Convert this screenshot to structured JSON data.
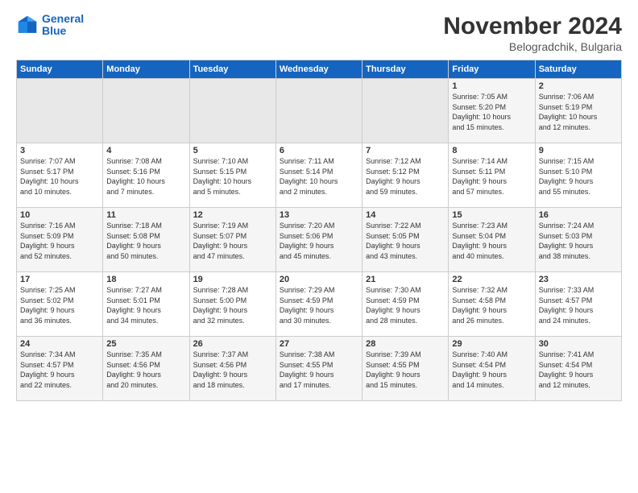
{
  "logo": {
    "line1": "General",
    "line2": "Blue"
  },
  "title": "November 2024",
  "subtitle": "Belogradchik, Bulgaria",
  "days_of_week": [
    "Sunday",
    "Monday",
    "Tuesday",
    "Wednesday",
    "Thursday",
    "Friday",
    "Saturday"
  ],
  "weeks": [
    {
      "days": [
        {
          "num": "",
          "info": "",
          "empty": true
        },
        {
          "num": "",
          "info": "",
          "empty": true
        },
        {
          "num": "",
          "info": "",
          "empty": true
        },
        {
          "num": "",
          "info": "",
          "empty": true
        },
        {
          "num": "",
          "info": "",
          "empty": true
        },
        {
          "num": "1",
          "info": "Sunrise: 7:05 AM\nSunset: 5:20 PM\nDaylight: 10 hours\nand 15 minutes."
        },
        {
          "num": "2",
          "info": "Sunrise: 7:06 AM\nSunset: 5:19 PM\nDaylight: 10 hours\nand 12 minutes."
        }
      ]
    },
    {
      "days": [
        {
          "num": "3",
          "info": "Sunrise: 7:07 AM\nSunset: 5:17 PM\nDaylight: 10 hours\nand 10 minutes."
        },
        {
          "num": "4",
          "info": "Sunrise: 7:08 AM\nSunset: 5:16 PM\nDaylight: 10 hours\nand 7 minutes."
        },
        {
          "num": "5",
          "info": "Sunrise: 7:10 AM\nSunset: 5:15 PM\nDaylight: 10 hours\nand 5 minutes."
        },
        {
          "num": "6",
          "info": "Sunrise: 7:11 AM\nSunset: 5:14 PM\nDaylight: 10 hours\nand 2 minutes."
        },
        {
          "num": "7",
          "info": "Sunrise: 7:12 AM\nSunset: 5:12 PM\nDaylight: 9 hours\nand 59 minutes."
        },
        {
          "num": "8",
          "info": "Sunrise: 7:14 AM\nSunset: 5:11 PM\nDaylight: 9 hours\nand 57 minutes."
        },
        {
          "num": "9",
          "info": "Sunrise: 7:15 AM\nSunset: 5:10 PM\nDaylight: 9 hours\nand 55 minutes."
        }
      ]
    },
    {
      "days": [
        {
          "num": "10",
          "info": "Sunrise: 7:16 AM\nSunset: 5:09 PM\nDaylight: 9 hours\nand 52 minutes."
        },
        {
          "num": "11",
          "info": "Sunrise: 7:18 AM\nSunset: 5:08 PM\nDaylight: 9 hours\nand 50 minutes."
        },
        {
          "num": "12",
          "info": "Sunrise: 7:19 AM\nSunset: 5:07 PM\nDaylight: 9 hours\nand 47 minutes."
        },
        {
          "num": "13",
          "info": "Sunrise: 7:20 AM\nSunset: 5:06 PM\nDaylight: 9 hours\nand 45 minutes."
        },
        {
          "num": "14",
          "info": "Sunrise: 7:22 AM\nSunset: 5:05 PM\nDaylight: 9 hours\nand 43 minutes."
        },
        {
          "num": "15",
          "info": "Sunrise: 7:23 AM\nSunset: 5:04 PM\nDaylight: 9 hours\nand 40 minutes."
        },
        {
          "num": "16",
          "info": "Sunrise: 7:24 AM\nSunset: 5:03 PM\nDaylight: 9 hours\nand 38 minutes."
        }
      ]
    },
    {
      "days": [
        {
          "num": "17",
          "info": "Sunrise: 7:25 AM\nSunset: 5:02 PM\nDaylight: 9 hours\nand 36 minutes."
        },
        {
          "num": "18",
          "info": "Sunrise: 7:27 AM\nSunset: 5:01 PM\nDaylight: 9 hours\nand 34 minutes."
        },
        {
          "num": "19",
          "info": "Sunrise: 7:28 AM\nSunset: 5:00 PM\nDaylight: 9 hours\nand 32 minutes."
        },
        {
          "num": "20",
          "info": "Sunrise: 7:29 AM\nSunset: 4:59 PM\nDaylight: 9 hours\nand 30 minutes."
        },
        {
          "num": "21",
          "info": "Sunrise: 7:30 AM\nSunset: 4:59 PM\nDaylight: 9 hours\nand 28 minutes."
        },
        {
          "num": "22",
          "info": "Sunrise: 7:32 AM\nSunset: 4:58 PM\nDaylight: 9 hours\nand 26 minutes."
        },
        {
          "num": "23",
          "info": "Sunrise: 7:33 AM\nSunset: 4:57 PM\nDaylight: 9 hours\nand 24 minutes."
        }
      ]
    },
    {
      "days": [
        {
          "num": "24",
          "info": "Sunrise: 7:34 AM\nSunset: 4:57 PM\nDaylight: 9 hours\nand 22 minutes."
        },
        {
          "num": "25",
          "info": "Sunrise: 7:35 AM\nSunset: 4:56 PM\nDaylight: 9 hours\nand 20 minutes."
        },
        {
          "num": "26",
          "info": "Sunrise: 7:37 AM\nSunset: 4:56 PM\nDaylight: 9 hours\nand 18 minutes."
        },
        {
          "num": "27",
          "info": "Sunrise: 7:38 AM\nSunset: 4:55 PM\nDaylight: 9 hours\nand 17 minutes."
        },
        {
          "num": "28",
          "info": "Sunrise: 7:39 AM\nSunset: 4:55 PM\nDaylight: 9 hours\nand 15 minutes."
        },
        {
          "num": "29",
          "info": "Sunrise: 7:40 AM\nSunset: 4:54 PM\nDaylight: 9 hours\nand 14 minutes."
        },
        {
          "num": "30",
          "info": "Sunrise: 7:41 AM\nSunset: 4:54 PM\nDaylight: 9 hours\nand 12 minutes."
        }
      ]
    }
  ]
}
